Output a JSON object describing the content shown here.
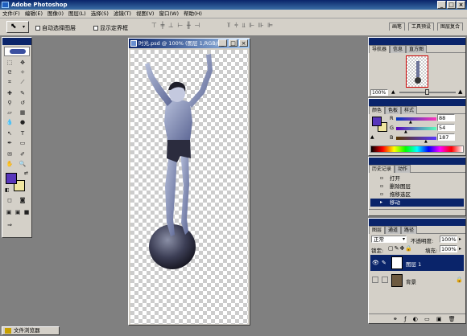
{
  "app": {
    "title": "Adobe Photoshop"
  },
  "menu": [
    "文件(F)",
    "编辑(E)",
    "图像(I)",
    "图层(L)",
    "选择(S)",
    "滤镜(T)",
    "视图(V)",
    "窗口(W)",
    "帮助(H)"
  ],
  "options_bar": {
    "auto_select": "自动选择图层",
    "show_bounds": "显示定界框",
    "right_tabs": [
      "画笔",
      "工具预设",
      "图层复合"
    ]
  },
  "document": {
    "title": "时光.psd @ 100% (图层 1,RGB/8#)"
  },
  "navigator": {
    "tabs": [
      "导航器",
      "信息",
      "直方图"
    ],
    "zoom": "100%"
  },
  "color": {
    "tabs": [
      "颜色",
      "色板",
      "样式"
    ],
    "channels": [
      {
        "label": "R",
        "value": "88"
      },
      {
        "label": "G",
        "value": "54"
      },
      {
        "label": "B",
        "value": "187"
      }
    ],
    "fg_color": "#5836bb",
    "bg_color": "#f0e6a0"
  },
  "history": {
    "tabs": [
      "历史记录",
      "动作"
    ],
    "items": [
      "打开",
      "删除图层",
      "拖移选区",
      "移动"
    ]
  },
  "layers": {
    "tabs": [
      "图层",
      "通道",
      "路径"
    ],
    "blend_mode": "正常",
    "opacity_label": "不透明度:",
    "opacity": "100%",
    "lock_label": "锁定:",
    "fill_label": "填充:",
    "fill": "100%",
    "items": [
      {
        "name": "图层 1"
      },
      {
        "name": "背景"
      }
    ]
  },
  "taskbar": {
    "item": "文件浏览器"
  }
}
